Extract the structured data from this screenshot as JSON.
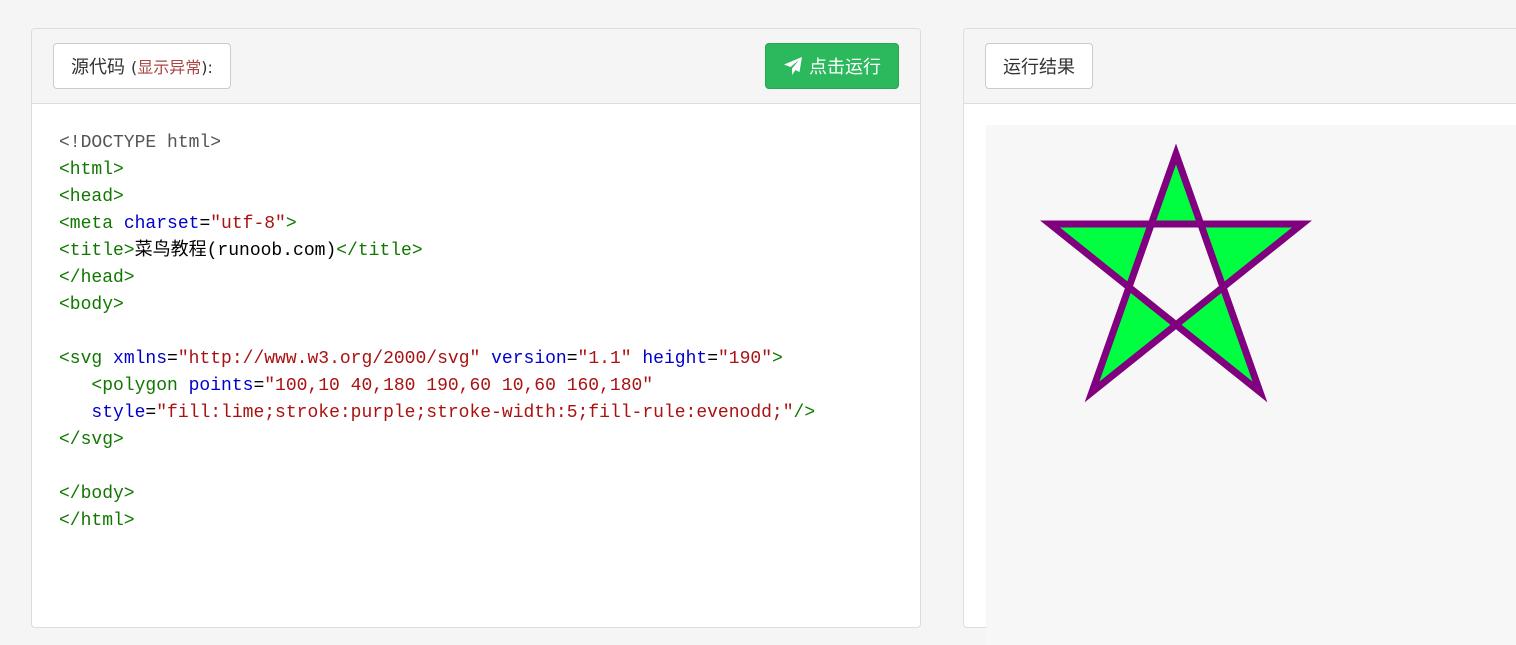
{
  "source_panel": {
    "label": "源代码",
    "hint_open": "(",
    "hint_error": "显示异常",
    "hint_close": "):",
    "run_button_label": "点击运行",
    "run_icon": "paper-plane-icon"
  },
  "result_panel": {
    "label": "运行结果"
  },
  "code_lines": [
    [
      {
        "t": "doc",
        "v": "<!DOCTYPE html>"
      }
    ],
    [
      {
        "t": "tag",
        "v": "<html>"
      }
    ],
    [
      {
        "t": "tag",
        "v": "<head>"
      }
    ],
    [
      {
        "t": "tag",
        "v": "<meta "
      },
      {
        "t": "attr",
        "v": "charset"
      },
      {
        "t": "txt",
        "v": "="
      },
      {
        "t": "str",
        "v": "\"utf-8\""
      },
      {
        "t": "tag",
        "v": ">"
      }
    ],
    [
      {
        "t": "tag",
        "v": "<title>"
      },
      {
        "t": "txt",
        "v": "菜鸟教程(runoob.com)"
      },
      {
        "t": "tag",
        "v": "</title>"
      }
    ],
    [
      {
        "t": "tag",
        "v": "</head>"
      }
    ],
    [
      {
        "t": "tag",
        "v": "<body>"
      }
    ],
    [],
    [
      {
        "t": "tag",
        "v": "<svg "
      },
      {
        "t": "attr",
        "v": "xmlns"
      },
      {
        "t": "txt",
        "v": "="
      },
      {
        "t": "str",
        "v": "\"http://www.w3.org/2000/svg\""
      },
      {
        "t": "txt",
        "v": " "
      },
      {
        "t": "attr",
        "v": "version"
      },
      {
        "t": "txt",
        "v": "="
      },
      {
        "t": "str",
        "v": "\"1.1\""
      },
      {
        "t": "txt",
        "v": " "
      },
      {
        "t": "attr",
        "v": "height"
      },
      {
        "t": "txt",
        "v": "="
      },
      {
        "t": "str",
        "v": "\"190\""
      },
      {
        "t": "tag",
        "v": ">"
      }
    ],
    [
      {
        "t": "txt",
        "v": "   "
      },
      {
        "t": "tag",
        "v": "<polygon "
      },
      {
        "t": "attr",
        "v": "points"
      },
      {
        "t": "txt",
        "v": "="
      },
      {
        "t": "str",
        "v": "\"100,10 40,180 190,60 10,60 160,180\""
      }
    ],
    [
      {
        "t": "txt",
        "v": "   "
      },
      {
        "t": "attr",
        "v": "style"
      },
      {
        "t": "txt",
        "v": "="
      },
      {
        "t": "str",
        "v": "\"fill:lime;stroke:purple;stroke-width:5;fill-rule:evenodd;\""
      },
      {
        "t": "tag",
        "v": "/>"
      }
    ],
    [
      {
        "t": "tag",
        "v": "</svg>"
      }
    ],
    [],
    [
      {
        "t": "tag",
        "v": "</body>"
      }
    ],
    [
      {
        "t": "tag",
        "v": "</html>"
      }
    ]
  ],
  "result": {
    "fill": "#00ff40",
    "stroke": "#800080",
    "fill_rule": "evenodd",
    "shape": "star-polygon"
  },
  "colors": {
    "run_button": "#2cb85c",
    "error_hint": "#a94442"
  }
}
